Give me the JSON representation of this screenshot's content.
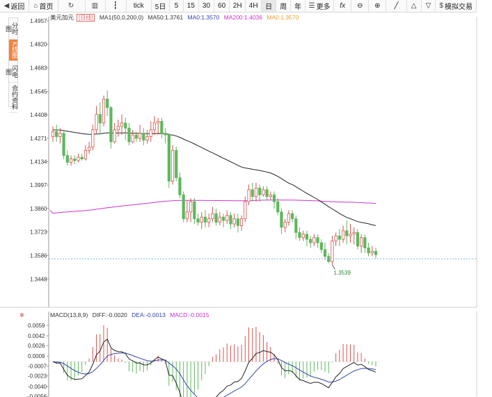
{
  "toolbar": {
    "back": "返回",
    "home": "首页",
    "refresh_icon": "refresh-icon",
    "bar_icon": "bar-chart-icon",
    "candle_icon": "candlestick-icon",
    "tick": "tick",
    "five_day": "5日",
    "p5": "5",
    "p15": "15",
    "p30": "30",
    "p60": "60",
    "p2h": "2H",
    "p4h": "4H",
    "day": "日",
    "week": "周",
    "year": "年",
    "more": "更多",
    "fx": "fx",
    "sim_trade": "模拟交易"
  },
  "leftbar": {
    "items": [
      "分时图",
      "K线图",
      "闪电图",
      "合约资料"
    ]
  },
  "header": {
    "name": "美元加元",
    "tag": "[日线]",
    "ma_main": "MA1(50,0,200,0)",
    "ma50": "MA50:1.3761",
    "ma0a": "MA0:1.3570",
    "ma200": "MA200:1.4036",
    "ma0b": "MA0:1.3570"
  },
  "macd_header": {
    "title": "MACD(13,8,9)",
    "diff": "DIFF:-0.0020",
    "dea": "DEA:-0.0013",
    "macd": "MACD:-0.0015"
  },
  "colors": {
    "up": "#d9534f",
    "down": "#5cb85c",
    "ma50": "#222222",
    "ma200": "#cc33cc",
    "dea": "#3344aa",
    "macd_label": "#cc33cc",
    "ma0": "#e8a030"
  },
  "chart_data": {
    "type": "candlestick",
    "price_ticks": [
      "1.4957",
      "1.4820",
      "1.4683",
      "1.4545",
      "1.4408",
      "1.4271",
      "1.4134",
      "1.3997",
      "1.3860",
      "1.3723",
      "1.3586",
      "1.3448"
    ],
    "low_marker": "1.3539",
    "macd_ticks": [
      "0.0059",
      "0.0042",
      "0.0026",
      "0.0009",
      "-0.0007",
      "-0.0023",
      "-0.0040",
      "-0.0056"
    ],
    "ylim": [
      1.338,
      1.4957
    ],
    "macd_ylim": [
      -0.0056,
      0.007
    ],
    "candles": [
      [
        1.428,
        1.431,
        1.425,
        1.434
      ],
      [
        1.431,
        1.428,
        1.425,
        1.435
      ],
      [
        1.428,
        1.43,
        1.424,
        1.433
      ],
      [
        1.43,
        1.417,
        1.415,
        1.432
      ],
      [
        1.417,
        1.413,
        1.411,
        1.42
      ],
      [
        1.413,
        1.415,
        1.411,
        1.417
      ],
      [
        1.415,
        1.414,
        1.412,
        1.417
      ],
      [
        1.414,
        1.416,
        1.413,
        1.418
      ],
      [
        1.416,
        1.415,
        1.414,
        1.418
      ],
      [
        1.415,
        1.42,
        1.414,
        1.423
      ],
      [
        1.42,
        1.422,
        1.418,
        1.425
      ],
      [
        1.422,
        1.432,
        1.42,
        1.435
      ],
      [
        1.432,
        1.441,
        1.43,
        1.446
      ],
      [
        1.441,
        1.436,
        1.43,
        1.448
      ],
      [
        1.436,
        1.45,
        1.434,
        1.452
      ],
      [
        1.45,
        1.445,
        1.44,
        1.455
      ],
      [
        1.445,
        1.425,
        1.421,
        1.446
      ],
      [
        1.425,
        1.432,
        1.424,
        1.436
      ],
      [
        1.432,
        1.434,
        1.428,
        1.438
      ],
      [
        1.434,
        1.436,
        1.429,
        1.441
      ],
      [
        1.436,
        1.433,
        1.426,
        1.439
      ],
      [
        1.433,
        1.425,
        1.423,
        1.436
      ],
      [
        1.425,
        1.429,
        1.424,
        1.432
      ],
      [
        1.429,
        1.427,
        1.425,
        1.431
      ],
      [
        1.427,
        1.43,
        1.425,
        1.435
      ],
      [
        1.43,
        1.426,
        1.423,
        1.433
      ],
      [
        1.426,
        1.428,
        1.424,
        1.432
      ],
      [
        1.428,
        1.432,
        1.425,
        1.437
      ],
      [
        1.432,
        1.436,
        1.429,
        1.44
      ],
      [
        1.436,
        1.437,
        1.429,
        1.439
      ],
      [
        1.437,
        1.43,
        1.427,
        1.439
      ],
      [
        1.43,
        1.429,
        1.424,
        1.433
      ],
      [
        1.429,
        1.402,
        1.398,
        1.43
      ],
      [
        1.402,
        1.42,
        1.4,
        1.423
      ],
      [
        1.42,
        1.404,
        1.402,
        1.422
      ],
      [
        1.404,
        1.394,
        1.392,
        1.407
      ],
      [
        1.394,
        1.38,
        1.378,
        1.396
      ],
      [
        1.38,
        1.384,
        1.378,
        1.391
      ],
      [
        1.384,
        1.39,
        1.378,
        1.392
      ],
      [
        1.39,
        1.38,
        1.377,
        1.392
      ],
      [
        1.38,
        1.378,
        1.376,
        1.383
      ],
      [
        1.378,
        1.381,
        1.374,
        1.384
      ],
      [
        1.381,
        1.378,
        1.375,
        1.385
      ],
      [
        1.378,
        1.38,
        1.375,
        1.383
      ],
      [
        1.38,
        1.383,
        1.378,
        1.387
      ],
      [
        1.383,
        1.378,
        1.376,
        1.386
      ],
      [
        1.378,
        1.381,
        1.376,
        1.384
      ],
      [
        1.381,
        1.379,
        1.375,
        1.383
      ],
      [
        1.379,
        1.382,
        1.377,
        1.385
      ],
      [
        1.382,
        1.377,
        1.374,
        1.384
      ],
      [
        1.377,
        1.38,
        1.375,
        1.383
      ],
      [
        1.38,
        1.376,
        1.372,
        1.383
      ],
      [
        1.376,
        1.38,
        1.373,
        1.382
      ],
      [
        1.38,
        1.39,
        1.378,
        1.393
      ],
      [
        1.39,
        1.397,
        1.388,
        1.4
      ],
      [
        1.397,
        1.393,
        1.39,
        1.401
      ],
      [
        1.393,
        1.398,
        1.39,
        1.401
      ],
      [
        1.398,
        1.394,
        1.39,
        1.4
      ],
      [
        1.394,
        1.397,
        1.393,
        1.399
      ],
      [
        1.397,
        1.393,
        1.391,
        1.399
      ],
      [
        1.393,
        1.394,
        1.391,
        1.396
      ],
      [
        1.394,
        1.39,
        1.386,
        1.396
      ],
      [
        1.39,
        1.384,
        1.382,
        1.392
      ],
      [
        1.384,
        1.375,
        1.371,
        1.386
      ],
      [
        1.375,
        1.378,
        1.372,
        1.38
      ],
      [
        1.378,
        1.383,
        1.376,
        1.385
      ],
      [
        1.383,
        1.38,
        1.378,
        1.385
      ],
      [
        1.38,
        1.372,
        1.368,
        1.382
      ],
      [
        1.372,
        1.369,
        1.367,
        1.375
      ],
      [
        1.369,
        1.371,
        1.367,
        1.373
      ],
      [
        1.371,
        1.368,
        1.364,
        1.373
      ],
      [
        1.368,
        1.366,
        1.363,
        1.37
      ],
      [
        1.366,
        1.369,
        1.364,
        1.371
      ],
      [
        1.369,
        1.366,
        1.363,
        1.371
      ],
      [
        1.366,
        1.362,
        1.36,
        1.368
      ],
      [
        1.362,
        1.358,
        1.356,
        1.366
      ],
      [
        1.358,
        1.355,
        1.354,
        1.36
      ],
      [
        1.355,
        1.367,
        1.353,
        1.37
      ],
      [
        1.367,
        1.37,
        1.364,
        1.372
      ],
      [
        1.37,
        1.368,
        1.364,
        1.374
      ],
      [
        1.368,
        1.373,
        1.366,
        1.376
      ],
      [
        1.373,
        1.37,
        1.365,
        1.379
      ],
      [
        1.37,
        1.371,
        1.366,
        1.377
      ],
      [
        1.371,
        1.372,
        1.365,
        1.375
      ],
      [
        1.372,
        1.364,
        1.362,
        1.374
      ],
      [
        1.364,
        1.369,
        1.36,
        1.371
      ],
      [
        1.369,
        1.363,
        1.36,
        1.371
      ],
      [
        1.363,
        1.36,
        1.358,
        1.366
      ],
      [
        1.36,
        1.361,
        1.358,
        1.364
      ],
      [
        1.361,
        1.359,
        1.357,
        1.363
      ]
    ]
  }
}
